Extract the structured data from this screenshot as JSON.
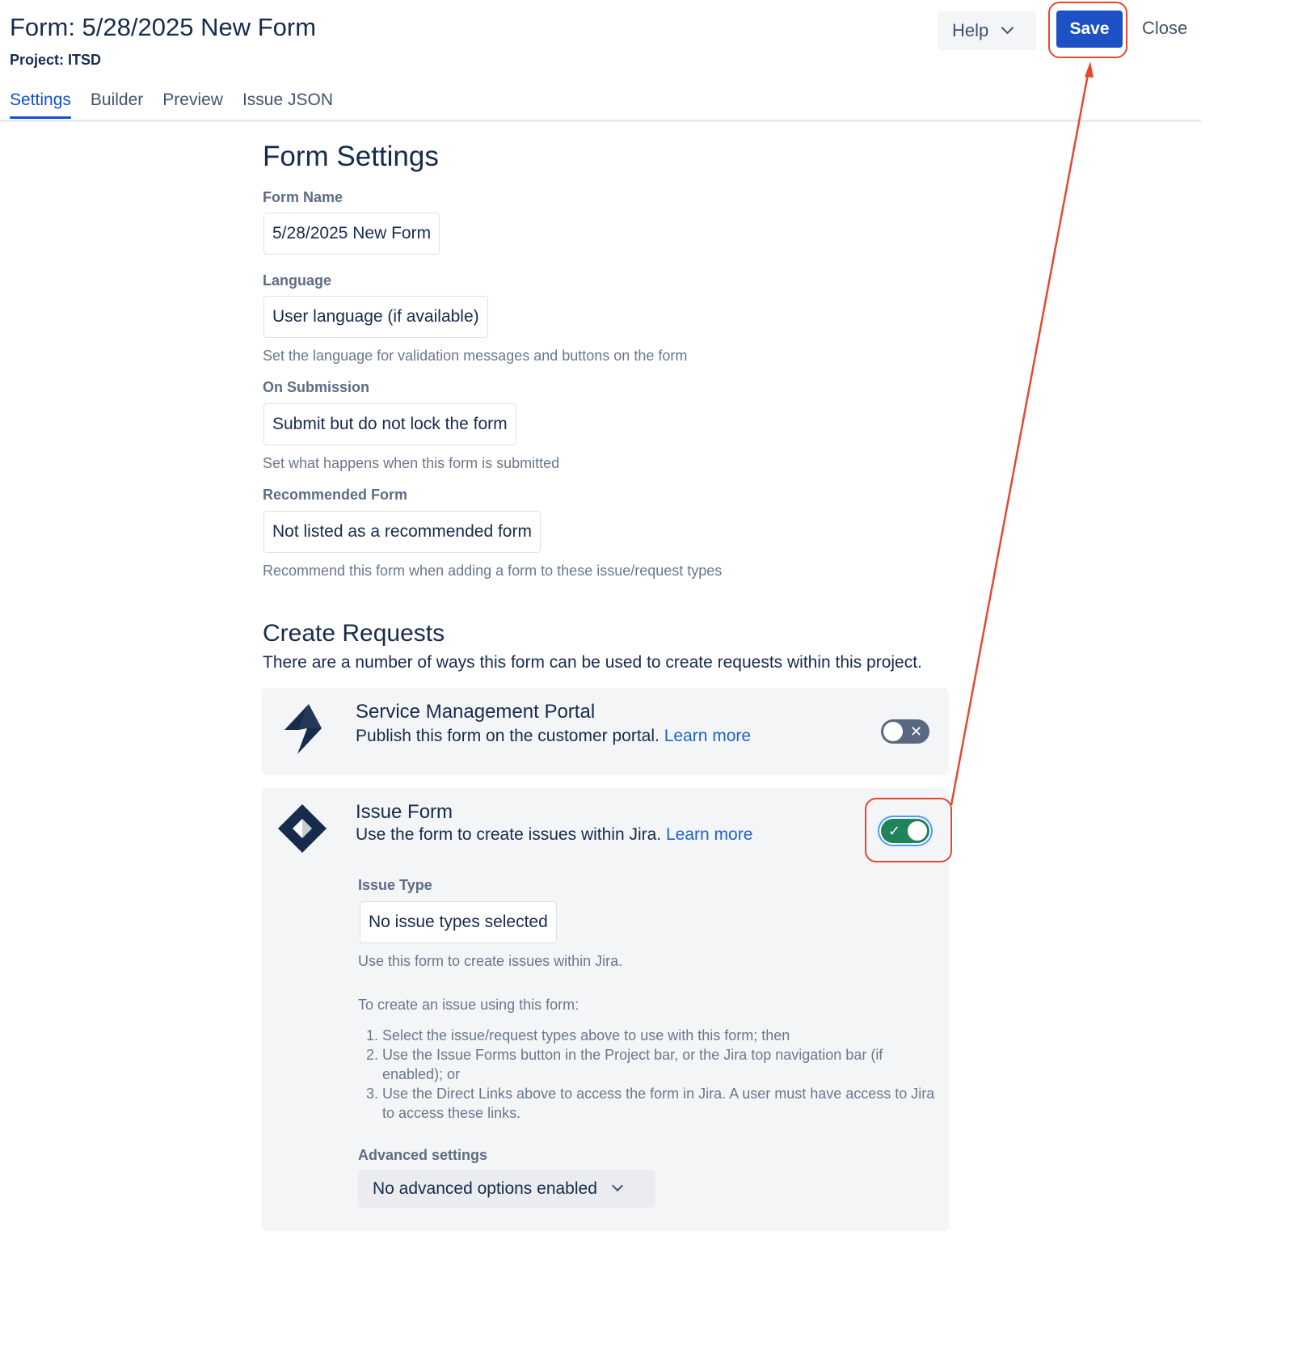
{
  "header": {
    "title": "Form: 5/28/2025 New Form",
    "project": "Project: ITSD",
    "help_label": "Help",
    "save_label": "Save",
    "close_label": "Close"
  },
  "tabs": [
    {
      "label": "Settings",
      "active": true
    },
    {
      "label": "Builder",
      "active": false
    },
    {
      "label": "Preview",
      "active": false
    },
    {
      "label": "Issue JSON",
      "active": false
    }
  ],
  "settings": {
    "heading": "Form Settings",
    "form_name": {
      "label": "Form Name",
      "value": "5/28/2025 New Form"
    },
    "language": {
      "label": "Language",
      "value": "User language (if available)",
      "hint": "Set the language for validation messages and buttons on the form"
    },
    "on_submission": {
      "label": "On Submission",
      "value": "Submit but do not lock the form",
      "hint": "Set what happens when this form is submitted"
    },
    "recommended": {
      "label": "Recommended Form",
      "value": "Not listed as a recommended form",
      "hint": "Recommend this form when adding a form to these issue/request types"
    }
  },
  "create_requests": {
    "heading": "Create Requests",
    "subtitle": "There are a number of ways this form can be used to create requests within this project.",
    "portal": {
      "title": "Service Management Portal",
      "desc": "Publish this form on the customer portal.",
      "link": "Learn more",
      "enabled": false
    },
    "issue_form": {
      "title": "Issue Form",
      "desc": "Use the form to create issues within Jira.",
      "link": "Learn more",
      "enabled": true,
      "issue_type": {
        "label": "Issue Type",
        "value": "No issue types selected",
        "hint": "Use this form to create issues within Jira."
      },
      "instructions_intro": "To create an issue using this form:",
      "steps": [
        "Select the issue/request types above to use with this form; then",
        "Use the Issue Forms button in the Project bar, or the Jira top navigation bar (if enabled); or",
        "Use the Direct Links above to access the form in Jira. A user must have access to Jira to access these links."
      ],
      "advanced": {
        "label": "Advanced settings",
        "value": "No advanced options enabled"
      }
    }
  },
  "colors": {
    "primary": "#1d51c6",
    "link": "#1d62d6",
    "toggle_on": "#1f845a",
    "toggle_off": "#596780",
    "annotation": "#e5492d"
  }
}
